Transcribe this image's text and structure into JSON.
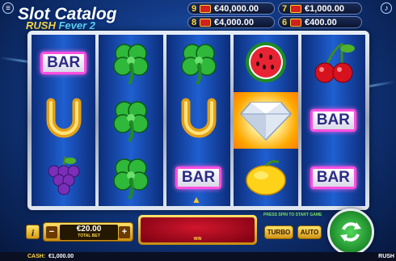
{
  "logo": {
    "site": "Slot Catalog",
    "game_word1": "RUSH",
    "game_word2": "Fever 2"
  },
  "jackpots": [
    {
      "count": "9",
      "value": "€40,000.00"
    },
    {
      "count": "7",
      "value": "€1,000.00"
    },
    {
      "count": "8",
      "value": "€4,000.00"
    },
    {
      "count": "6",
      "value": "€400.00"
    }
  ],
  "reels": {
    "symbols": [
      [
        "bar",
        "horseshoe",
        "grapes"
      ],
      [
        "clover",
        "clover",
        "clover"
      ],
      [
        "clover",
        "horseshoe",
        "bar"
      ],
      [
        "watermelon",
        "diamond",
        "lemon"
      ],
      [
        "cherries",
        "bar",
        "bar"
      ]
    ],
    "bar_text": "BAR"
  },
  "controls": {
    "info_label": "i",
    "minus_label": "−",
    "plus_label": "+",
    "bet_value": "€20.00",
    "bet_label": "TOTAL BET",
    "win_label": "WIN",
    "press_message": "PRESS SPIN TO START GAME",
    "turbo_label": "TURBO",
    "auto_label": "AUTO"
  },
  "status": {
    "cash_label": "CASH:",
    "cash_value": "€1,000.00",
    "brand": "RUSH"
  },
  "colors": {
    "accent_gold": "#ffd74a",
    "spin_green": "#1d8a2a",
    "win_red": "#d0162d",
    "bar_border": "#ff4fe0"
  }
}
